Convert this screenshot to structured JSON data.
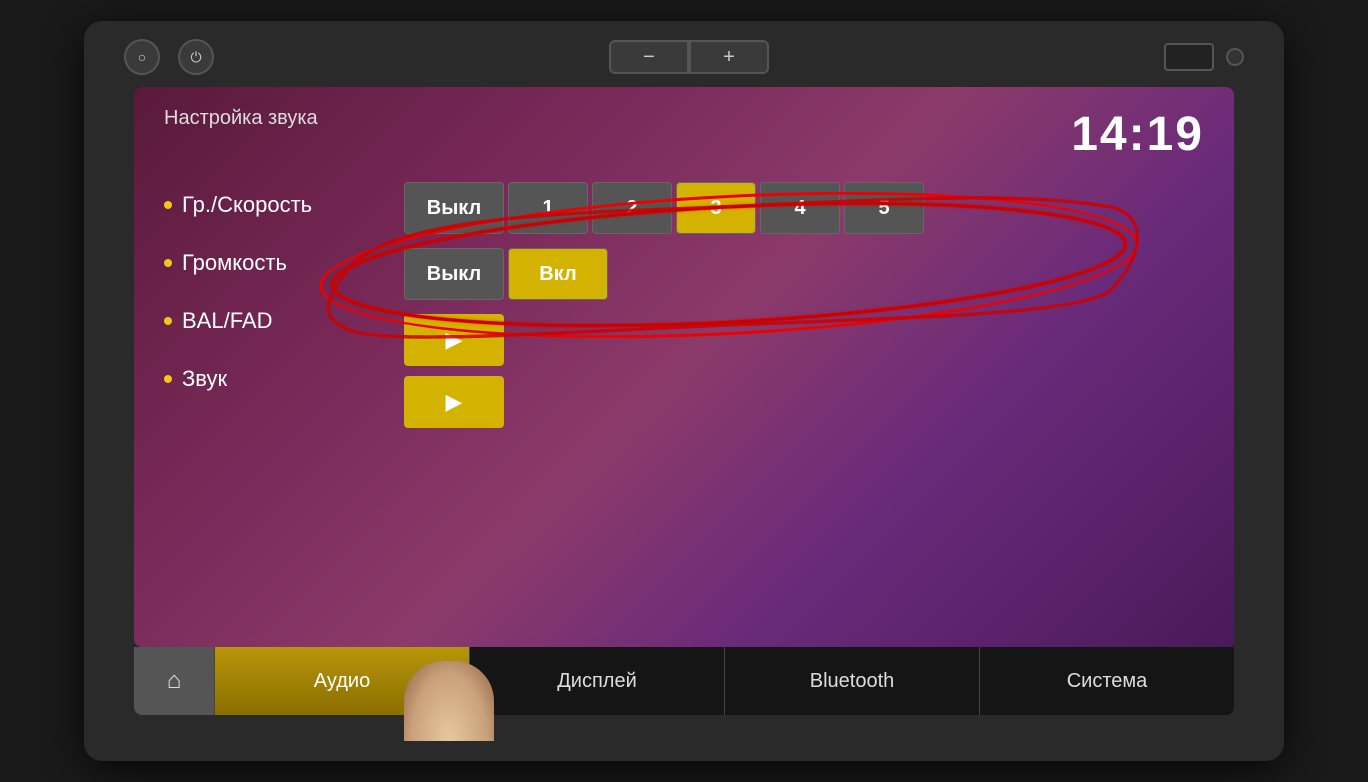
{
  "device": {
    "top_controls": {
      "circle_btn_icon": "○",
      "power_icon": "⏻",
      "minus_label": "−",
      "plus_label": "+"
    }
  },
  "screen": {
    "title": "Настройка звука",
    "time": "14:19",
    "menu": {
      "items": [
        {
          "id": "speed",
          "label": "Гр./Скорость",
          "dot": true
        },
        {
          "id": "volume",
          "label": "Громкость",
          "dot": true
        },
        {
          "id": "balfad",
          "label": "BAL/FAD",
          "dot": true
        },
        {
          "id": "sound",
          "label": "Звук",
          "dot": true
        }
      ]
    },
    "speed_buttons": [
      {
        "id": "off",
        "label": "Выкл",
        "active": false
      },
      {
        "id": "1",
        "label": "1",
        "active": false
      },
      {
        "id": "2",
        "label": "2",
        "active": false
      },
      {
        "id": "3",
        "label": "3",
        "active": true
      },
      {
        "id": "4",
        "label": "4",
        "active": false
      },
      {
        "id": "5",
        "label": "5",
        "active": false
      }
    ],
    "onoff_buttons": [
      {
        "id": "off2",
        "label": "Выкл",
        "active": false
      },
      {
        "id": "on",
        "label": "Вкл",
        "active": true
      }
    ],
    "bottom_nav": {
      "home_icon": "⌂",
      "tabs": [
        {
          "id": "audio",
          "label": "Аудио",
          "active": true
        },
        {
          "id": "display",
          "label": "Дисплей",
          "active": false
        },
        {
          "id": "bluetooth",
          "label": "Bluetooth",
          "active": false
        },
        {
          "id": "system",
          "label": "Система",
          "active": false
        }
      ]
    }
  }
}
